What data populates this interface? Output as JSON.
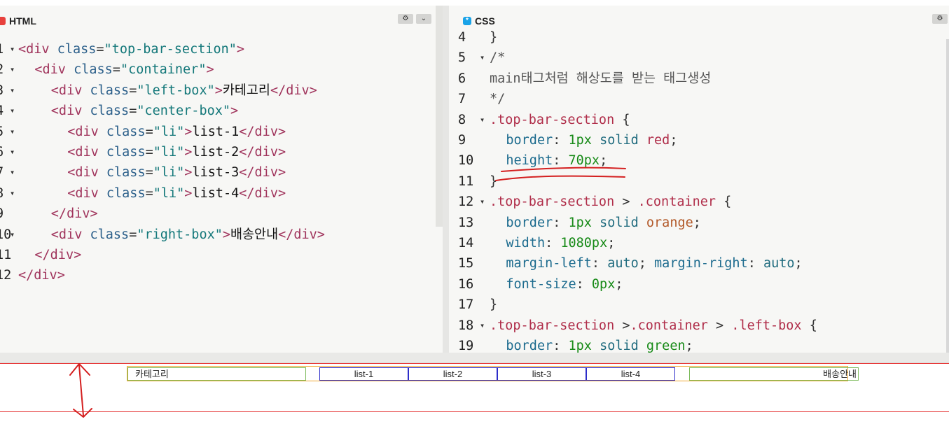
{
  "html_panel": {
    "title": "HTML",
    "settings_icon": "gear-icon",
    "collapse_icon": "chevron-down-icon",
    "lines": [
      {
        "n": "1",
        "fold": true,
        "indent": 0,
        "parts": [
          [
            "tag",
            "<div "
          ],
          [
            "attr",
            "class"
          ],
          [
            "pun",
            "="
          ],
          [
            "str",
            "\"top-bar-section\""
          ],
          [
            "tag",
            ">"
          ]
        ]
      },
      {
        "n": "2",
        "fold": true,
        "indent": 2,
        "parts": [
          [
            "tag",
            "<div "
          ],
          [
            "attr",
            "class"
          ],
          [
            "pun",
            "="
          ],
          [
            "str",
            "\"container\""
          ],
          [
            "tag",
            ">"
          ]
        ]
      },
      {
        "n": "3",
        "fold": true,
        "indent": 4,
        "parts": [
          [
            "tag",
            "<div "
          ],
          [
            "attr",
            "class"
          ],
          [
            "pun",
            "="
          ],
          [
            "str",
            "\"left-box\""
          ],
          [
            "tag",
            ">"
          ],
          [
            "txt",
            "카테고리"
          ],
          [
            "tag",
            "</div>"
          ]
        ]
      },
      {
        "n": "4",
        "fold": true,
        "indent": 4,
        "parts": [
          [
            "tag",
            "<div "
          ],
          [
            "attr",
            "class"
          ],
          [
            "pun",
            "="
          ],
          [
            "str",
            "\"center-box\""
          ],
          [
            "tag",
            ">"
          ]
        ]
      },
      {
        "n": "5",
        "fold": true,
        "indent": 6,
        "parts": [
          [
            "tag",
            "<div "
          ],
          [
            "attr",
            "class"
          ],
          [
            "pun",
            "="
          ],
          [
            "str",
            "\"li\""
          ],
          [
            "tag",
            ">"
          ],
          [
            "txt",
            "list-1"
          ],
          [
            "tag",
            "</div>"
          ]
        ]
      },
      {
        "n": "6",
        "fold": true,
        "indent": 6,
        "parts": [
          [
            "tag",
            "<div "
          ],
          [
            "attr",
            "class"
          ],
          [
            "pun",
            "="
          ],
          [
            "str",
            "\"li\""
          ],
          [
            "tag",
            ">"
          ],
          [
            "txt",
            "list-2"
          ],
          [
            "tag",
            "</div>"
          ]
        ]
      },
      {
        "n": "7",
        "fold": true,
        "indent": 6,
        "parts": [
          [
            "tag",
            "<div "
          ],
          [
            "attr",
            "class"
          ],
          [
            "pun",
            "="
          ],
          [
            "str",
            "\"li\""
          ],
          [
            "tag",
            ">"
          ],
          [
            "txt",
            "list-3"
          ],
          [
            "tag",
            "</div>"
          ]
        ]
      },
      {
        "n": "8",
        "fold": true,
        "indent": 6,
        "parts": [
          [
            "tag",
            "<div "
          ],
          [
            "attr",
            "class"
          ],
          [
            "pun",
            "="
          ],
          [
            "str",
            "\"li\""
          ],
          [
            "tag",
            ">"
          ],
          [
            "txt",
            "list-4"
          ],
          [
            "tag",
            "</div>"
          ]
        ]
      },
      {
        "n": "9",
        "fold": false,
        "indent": 4,
        "parts": [
          [
            "tag",
            "</div>"
          ]
        ]
      },
      {
        "n": "10",
        "fold": true,
        "indent": 4,
        "parts": [
          [
            "tag",
            "<div "
          ],
          [
            "attr",
            "class"
          ],
          [
            "pun",
            "="
          ],
          [
            "str",
            "\"right-box\""
          ],
          [
            "tag",
            ">"
          ],
          [
            "txt",
            "배송안내"
          ],
          [
            "tag",
            "</div>"
          ]
        ]
      },
      {
        "n": "11",
        "fold": false,
        "indent": 2,
        "parts": [
          [
            "tag",
            "</div>"
          ]
        ]
      },
      {
        "n": "12",
        "fold": false,
        "indent": 0,
        "parts": [
          [
            "tag",
            "</div>"
          ]
        ]
      }
    ]
  },
  "css_panel": {
    "title": "CSS",
    "settings_icon": "gear-icon",
    "lines": [
      {
        "n": "4",
        "fold": false,
        "indent": 0,
        "parts": [
          [
            "pun",
            "}"
          ]
        ]
      },
      {
        "n": "5",
        "fold": true,
        "indent": 0,
        "parts": [
          [
            "cm",
            "/*"
          ]
        ]
      },
      {
        "n": "6",
        "fold": false,
        "indent": 0,
        "parts": [
          [
            "cm",
            "main태그처럼 해상도를 받는 태그생성"
          ]
        ]
      },
      {
        "n": "7",
        "fold": false,
        "indent": 0,
        "parts": [
          [
            "cm",
            "*/"
          ]
        ]
      },
      {
        "n": "8",
        "fold": true,
        "indent": 0,
        "parts": [
          [
            "sel",
            ".top-bar-section"
          ],
          [
            "pun",
            " {"
          ]
        ]
      },
      {
        "n": "9",
        "fold": false,
        "indent": 2,
        "parts": [
          [
            "prop",
            "border"
          ],
          [
            "pun",
            ": "
          ],
          [
            "num",
            "1px"
          ],
          [
            "pun",
            " "
          ],
          [
            "kw2",
            "solid"
          ],
          [
            "pun",
            " "
          ],
          [
            "sel",
            "red"
          ],
          [
            "pun",
            ";"
          ]
        ]
      },
      {
        "n": "10",
        "fold": false,
        "indent": 2,
        "parts": [
          [
            "prop",
            "height"
          ],
          [
            "pun",
            ": "
          ],
          [
            "num",
            "70px"
          ],
          [
            "pun",
            ";"
          ]
        ]
      },
      {
        "n": "11",
        "fold": false,
        "indent": 0,
        "parts": [
          [
            "pun",
            "}"
          ]
        ]
      },
      {
        "n": "12",
        "fold": true,
        "indent": 0,
        "parts": [
          [
            "sel",
            ".top-bar-section"
          ],
          [
            "pun",
            " > "
          ],
          [
            "sel",
            ".container"
          ],
          [
            "pun",
            " {"
          ]
        ]
      },
      {
        "n": "13",
        "fold": false,
        "indent": 2,
        "parts": [
          [
            "prop",
            "border"
          ],
          [
            "pun",
            ": "
          ],
          [
            "num",
            "1px"
          ],
          [
            "pun",
            " "
          ],
          [
            "kw2",
            "solid"
          ],
          [
            "pun",
            " "
          ],
          [
            "kw",
            "orange"
          ],
          [
            "pun",
            ";"
          ]
        ]
      },
      {
        "n": "14",
        "fold": false,
        "indent": 2,
        "parts": [
          [
            "prop",
            "width"
          ],
          [
            "pun",
            ": "
          ],
          [
            "num",
            "1080px"
          ],
          [
            "pun",
            ";"
          ]
        ]
      },
      {
        "n": "15",
        "fold": false,
        "indent": 2,
        "parts": [
          [
            "prop",
            "margin-left"
          ],
          [
            "pun",
            ": "
          ],
          [
            "kw2",
            "auto"
          ],
          [
            "pun",
            "; "
          ],
          [
            "prop",
            "margin-right"
          ],
          [
            "pun",
            ": "
          ],
          [
            "kw2",
            "auto"
          ],
          [
            "pun",
            ";"
          ]
        ]
      },
      {
        "n": "16",
        "fold": false,
        "indent": 2,
        "parts": [
          [
            "prop",
            "font-size"
          ],
          [
            "pun",
            ": "
          ],
          [
            "num",
            "0px"
          ],
          [
            "pun",
            ";"
          ]
        ]
      },
      {
        "n": "17",
        "fold": false,
        "indent": 0,
        "parts": [
          [
            "pun",
            "}"
          ]
        ]
      },
      {
        "n": "18",
        "fold": true,
        "indent": 0,
        "parts": [
          [
            "sel",
            ".top-bar-section"
          ],
          [
            "pun",
            " >"
          ],
          [
            "sel",
            ".container"
          ],
          [
            "pun",
            " > "
          ],
          [
            "sel",
            ".left-box"
          ],
          [
            "pun",
            " {"
          ]
        ]
      },
      {
        "n": "19",
        "fold": false,
        "indent": 2,
        "parts": [
          [
            "prop",
            "border"
          ],
          [
            "pun",
            ": "
          ],
          [
            "num",
            "1px"
          ],
          [
            "pun",
            " "
          ],
          [
            "kw2",
            "solid"
          ],
          [
            "pun",
            " "
          ],
          [
            "num",
            "green"
          ],
          [
            "pun",
            ";"
          ]
        ]
      }
    ]
  },
  "preview": {
    "left_box": "카테고리",
    "list_items": [
      "list-1",
      "list-2",
      "list-3",
      "list-4"
    ],
    "right_box": "배송안내"
  },
  "colors": {
    "red_border": "#e63838",
    "orange_border": "#f0a732",
    "green_border": "#7dbb5c",
    "blue_border": "#2d2dc9",
    "annotation": "#d42020"
  }
}
